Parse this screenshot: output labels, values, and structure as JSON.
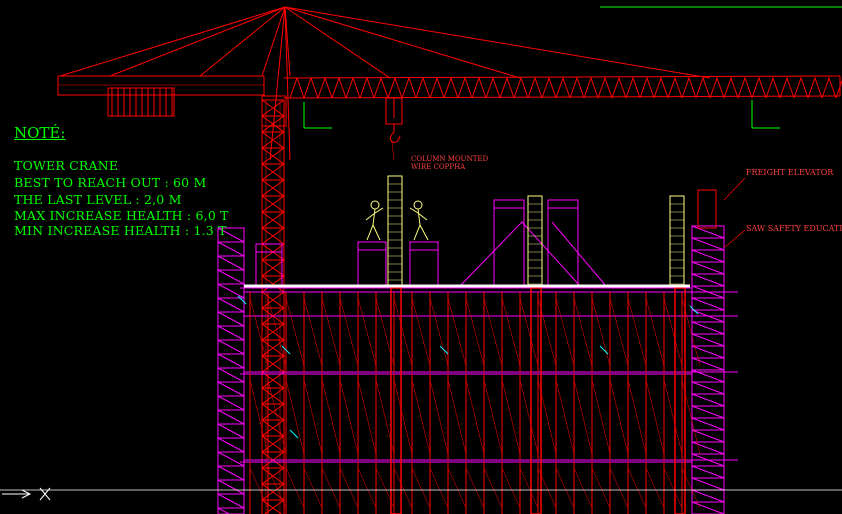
{
  "note": {
    "title": "NOTÉ:",
    "lines": [
      "TOWER CRANE",
      "BEST TO REACH OUT : 60 M",
      "THE LAST LEVEL : 2,0 M",
      "MAX INCREASE HEALTH : 6,0 T",
      "MIN INCREASE HEALTH : 1.3 T"
    ]
  },
  "labels": {
    "column_mounted": "COLUMN MOUNTED",
    "wire_coppha": "WIRE COPPHA",
    "freight_elevator": "FREIGHT ELEVATOR",
    "saw_safety": "SAW SAFETY EDUCATI"
  },
  "colors": {
    "background": "#000000",
    "crane": "#ff0000",
    "scaffold": "#ff00ff",
    "formwork": "#ffff80",
    "annotation": "#00ff00",
    "cyan": "#00ffff"
  }
}
